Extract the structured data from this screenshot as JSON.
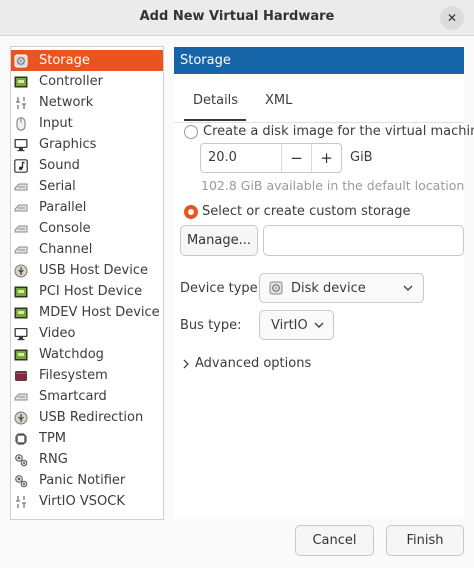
{
  "window": {
    "title": "Add New Virtual Hardware",
    "close_glyph": "✕"
  },
  "sidebar": {
    "items": [
      {
        "label": "Storage",
        "icon": "storage-icon",
        "selected": true
      },
      {
        "label": "Controller",
        "icon": "controller-icon"
      },
      {
        "label": "Network",
        "icon": "network-icon"
      },
      {
        "label": "Input",
        "icon": "mouse-icon"
      },
      {
        "label": "Graphics",
        "icon": "display-icon"
      },
      {
        "label": "Sound",
        "icon": "sound-icon"
      },
      {
        "label": "Serial",
        "icon": "serial-icon"
      },
      {
        "label": "Parallel",
        "icon": "parallel-icon"
      },
      {
        "label": "Console",
        "icon": "console-icon"
      },
      {
        "label": "Channel",
        "icon": "channel-icon"
      },
      {
        "label": "USB Host Device",
        "icon": "usb-icon"
      },
      {
        "label": "PCI Host Device",
        "icon": "pci-icon"
      },
      {
        "label": "MDEV Host Device",
        "icon": "mdev-icon"
      },
      {
        "label": "Video",
        "icon": "video-icon"
      },
      {
        "label": "Watchdog",
        "icon": "watchdog-icon"
      },
      {
        "label": "Filesystem",
        "icon": "filesystem-icon"
      },
      {
        "label": "Smartcard",
        "icon": "smartcard-icon"
      },
      {
        "label": "USB Redirection",
        "icon": "usb-redirection-icon"
      },
      {
        "label": "TPM",
        "icon": "tpm-icon"
      },
      {
        "label": "RNG",
        "icon": "rng-icon"
      },
      {
        "label": "Panic Notifier",
        "icon": "panic-notifier-icon"
      },
      {
        "label": "VirtIO VSOCK",
        "icon": "vsock-icon"
      }
    ]
  },
  "panel": {
    "header": "Storage",
    "tabs": [
      {
        "label": "Details",
        "active": true
      },
      {
        "label": "XML",
        "active": false
      }
    ],
    "create_disk_label": "Create a disk image for the virtual machine",
    "disk_size_value": "20.0",
    "minus_glyph": "−",
    "plus_glyph": "+",
    "size_unit": "GiB",
    "available_text": "102.8 GiB available in the default location",
    "custom_storage_label": "Select or create custom storage",
    "manage_button": "Manage...",
    "device_type_label": "Device type:",
    "device_type_value": "Disk device",
    "bus_type_label": "Bus type:",
    "bus_type_value": "VirtIO",
    "advanced_options": "Advanced options"
  },
  "footer": {
    "cancel": "Cancel",
    "finish": "Finish"
  },
  "colors": {
    "accent": "#e95420",
    "header_blue": "#1565a8"
  }
}
